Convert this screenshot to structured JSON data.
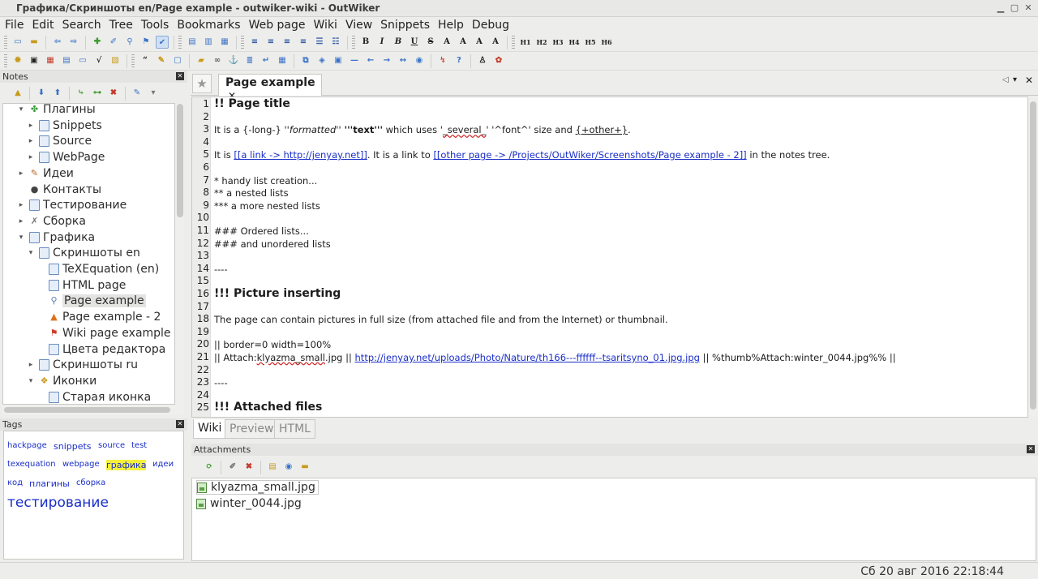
{
  "window": {
    "title": "Графика/Скриншоты en/Page example - outwiker-wiki - OutWiker"
  },
  "menubar": [
    "File",
    "Edit",
    "Search",
    "Tree",
    "Tools",
    "Bookmarks",
    "Web page",
    "Wiki",
    "View",
    "Snippets",
    "Help",
    "Debug"
  ],
  "toolbar_format": {
    "heading_buttons": [
      "H1",
      "H2",
      "H3",
      "H4",
      "H5",
      "H6"
    ]
  },
  "notes_panel": {
    "title": "Notes",
    "tree": [
      {
        "label": "Плагины",
        "level": 1,
        "arrow": "▾",
        "icon": "puzzle-icon",
        "glyph": "✤",
        "color": "#3a9a3a"
      },
      {
        "label": "Snippets",
        "level": 2,
        "arrow": "▸",
        "icon": "page-icon",
        "glyph": "",
        "color": "#3a74c8"
      },
      {
        "label": "Source",
        "level": 2,
        "arrow": "▸",
        "icon": "page-icon",
        "glyph": "",
        "color": "#3a74c8"
      },
      {
        "label": "WebPage",
        "level": 2,
        "arrow": "▸",
        "icon": "page-icon",
        "glyph": "",
        "color": "#3a74c8"
      },
      {
        "label": "Идеи",
        "level": 1,
        "arrow": "▸",
        "icon": "notepad-icon",
        "glyph": "✎",
        "color": "#b86a2a"
      },
      {
        "label": "Контакты",
        "level": 1,
        "arrow": "",
        "icon": "user-icon",
        "glyph": "●",
        "color": "#444444"
      },
      {
        "label": "Тестирование",
        "level": 1,
        "arrow": "▸",
        "icon": "page-icon",
        "glyph": "",
        "color": "#3a74c8"
      },
      {
        "label": "Сборка",
        "level": 1,
        "arrow": "▸",
        "icon": "wrench-icon",
        "glyph": "✗",
        "color": "#777777"
      },
      {
        "label": "Графика",
        "level": 1,
        "arrow": "▾",
        "icon": "page-icon",
        "glyph": "",
        "color": "#3a74c8"
      },
      {
        "label": "Скриншоты en",
        "level": 2,
        "arrow": "▾",
        "icon": "page-icon",
        "glyph": "",
        "color": "#3a74c8"
      },
      {
        "label": "TeXEquation (en)",
        "level": 3,
        "arrow": "",
        "icon": "page-icon",
        "glyph": "",
        "color": "#3a74c8"
      },
      {
        "label": "HTML page",
        "level": 3,
        "arrow": "",
        "icon": "page-icon",
        "glyph": "",
        "color": "#3a74c8"
      },
      {
        "label": "Page example",
        "level": 3,
        "arrow": "",
        "icon": "lock-icon",
        "glyph": "⚲",
        "color": "#5a78b8",
        "selected": true
      },
      {
        "label": "Page example - 2",
        "level": 3,
        "arrow": "",
        "icon": "cone-icon",
        "glyph": "▲",
        "color": "#e0701a"
      },
      {
        "label": "Wiki page example",
        "level": 3,
        "arrow": "",
        "icon": "bookmark-icon",
        "glyph": "⚑",
        "color": "#d03a2a"
      },
      {
        "label": "Цвета редактора",
        "level": 3,
        "arrow": "",
        "icon": "page-icon",
        "glyph": "",
        "color": "#3a74c8"
      },
      {
        "label": "Скриншоты ru",
        "level": 2,
        "arrow": "▸",
        "icon": "page-icon",
        "glyph": "",
        "color": "#3a74c8"
      },
      {
        "label": "Иконки",
        "level": 2,
        "arrow": "▾",
        "icon": "images-icon",
        "glyph": "❖",
        "color": "#c89a1a"
      },
      {
        "label": "Старая иконка",
        "level": 3,
        "arrow": "",
        "icon": "page-icon",
        "glyph": "",
        "color": "#3a74c8"
      }
    ]
  },
  "tags_panel": {
    "title": "Tags",
    "tags": [
      {
        "label": "hackpage",
        "size": 10,
        "highlight": false,
        "row": 0
      },
      {
        "label": "snippets",
        "size": 11,
        "highlight": false,
        "row": 0
      },
      {
        "label": "source",
        "size": 10,
        "highlight": false,
        "row": 0
      },
      {
        "label": "test",
        "size": 10,
        "highlight": false,
        "row": 0
      },
      {
        "label": "texequation",
        "size": 10,
        "highlight": false,
        "row": 1
      },
      {
        "label": "webpage",
        "size": 10,
        "highlight": false,
        "row": 1
      },
      {
        "label": "графика",
        "size": 11,
        "highlight": true,
        "row": 1
      },
      {
        "label": "идеи",
        "size": 10,
        "highlight": false,
        "row": 1
      },
      {
        "label": "код",
        "size": 10,
        "highlight": false,
        "row": 2
      },
      {
        "label": "плагины",
        "size": 11,
        "highlight": false,
        "row": 2
      },
      {
        "label": "сборка",
        "size": 10,
        "highlight": false,
        "row": 2
      },
      {
        "label": "тестирование",
        "size": 17,
        "highlight": false,
        "row": 3
      }
    ]
  },
  "page_tab": {
    "title": "Page example"
  },
  "editor": {
    "lines": [
      [
        {
          "t": "!! Page title",
          "c": "h"
        }
      ],
      [],
      [
        {
          "t": "It is a {-long-} "
        },
        {
          "t": "''formatted''",
          "c": "i"
        },
        {
          "t": " '''text'''",
          "c": "b"
        },
        {
          "t": " which uses '"
        },
        {
          "t": "_several_",
          "c": "squig"
        },
        {
          "t": "' '^font^' size and "
        },
        {
          "t": "{+other+}",
          "c": "u"
        },
        {
          "t": "."
        }
      ],
      [],
      [
        {
          "t": "It is "
        },
        {
          "t": "[[a link -> http://jenyay.net]]",
          "c": "lnk"
        },
        {
          "t": ". It is a link to "
        },
        {
          "t": "[[other page -> /Projects/OutWiker/Screenshots/Page example - 2]]",
          "c": "lnk"
        },
        {
          "t": " in the notes tree."
        }
      ],
      [],
      [
        {
          "t": "* handy list creation..."
        }
      ],
      [
        {
          "t": "** a nested lists"
        }
      ],
      [
        {
          "t": "*** a more nested lists"
        }
      ],
      [],
      [
        {
          "t": "### Ordered lists..."
        }
      ],
      [
        {
          "t": "### and unordered lists"
        }
      ],
      [],
      [
        {
          "t": "----"
        }
      ],
      [],
      [
        {
          "t": "!!! Picture inserting",
          "c": "h"
        }
      ],
      [],
      [
        {
          "t": "The page can contain pictures in full size (from attached file and from the Internet) or thumbnail."
        }
      ],
      [],
      [
        {
          "t": "|| border=0 width=100%"
        }
      ],
      [
        {
          "t": "|| Attach:"
        },
        {
          "t": "klyazma_small",
          "c": "squig"
        },
        {
          "t": ".jpg || "
        },
        {
          "t": "http://jenyay.net/uploads/Photo/Nature/th166---ffffff--tsaritsyno_01.jpg.jpg",
          "c": "lnk"
        },
        {
          "t": " || %thumb%Attach:winter_0044.jpg%% ||"
        }
      ],
      [],
      [
        {
          "t": "----"
        }
      ],
      [],
      [
        {
          "t": "!!! Attached files",
          "c": "h"
        }
      ]
    ]
  },
  "editor_tabs": [
    {
      "label": "Wiki",
      "active": true
    },
    {
      "label": "Preview",
      "active": false
    },
    {
      "label": "HTML",
      "active": false
    }
  ],
  "attachments_panel": {
    "title": "Attachments",
    "files": [
      "klyazma_small.jpg",
      "winter_0044.jpg"
    ]
  },
  "statusbar": {
    "datetime": "Сб 20 авг 2016 22:18:44"
  }
}
